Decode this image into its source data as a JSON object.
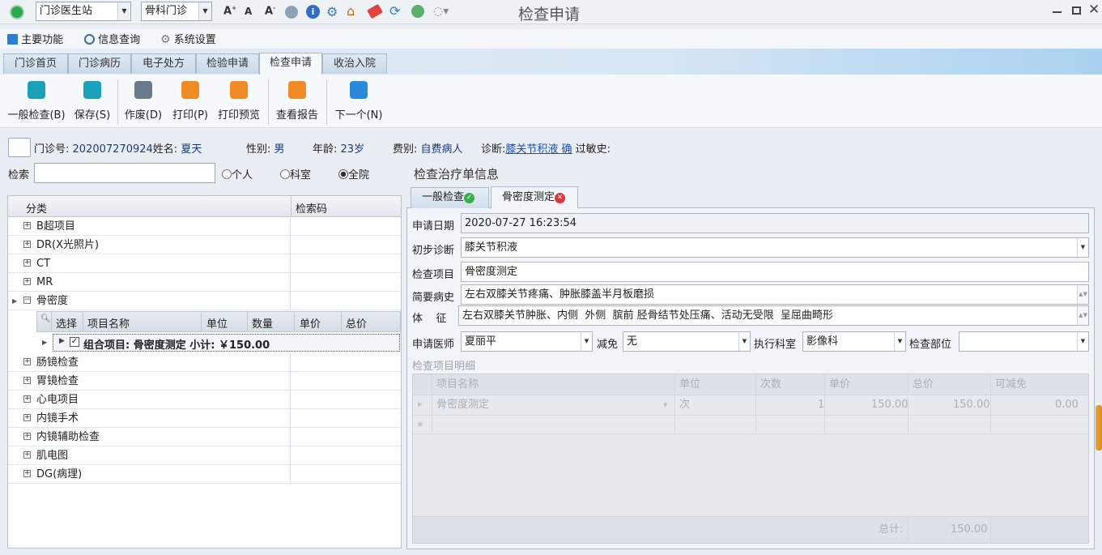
{
  "title": "检查申请",
  "topbar": {
    "station_select": "门诊医生站",
    "dept_select": "骨科门诊",
    "icons": [
      "font-increase-icon",
      "font-normal-icon",
      "font-decrease-icon",
      "users-gear-icon",
      "info-icon",
      "settings-icon",
      "home-icon",
      "eraser-icon",
      "refresh-icon",
      "people-icon",
      "loading-icon"
    ]
  },
  "menu": {
    "items": [
      "主要功能",
      "信息查询",
      "系统设置"
    ]
  },
  "tabs": [
    "门诊首页",
    "门诊病历",
    "电子处方",
    "检验申请",
    "检查申请",
    "收治入院"
  ],
  "active_tab": 4,
  "toolbar": {
    "buttons": [
      "一般检查(B)",
      "保存(S)",
      "作废(D)",
      "打印(P)",
      "打印预览",
      "查看报告",
      "下一个(N)"
    ],
    "colors": [
      "#1aa0b8",
      "#1aa0b8",
      "#6a7b8c",
      "#f08a24",
      "#f08a24",
      "#f08a24",
      "#2a8ad8"
    ]
  },
  "patient": {
    "clinic_no_label": "门诊号:",
    "clinic_no": "202007270924",
    "name_label": "姓名:",
    "name": "夏天",
    "gender_label": "性别:",
    "gender": "男",
    "age_label": "年龄:",
    "age": "23岁",
    "fee_label": "费别:",
    "fee": "自费病人",
    "diag_label": "诊断:",
    "diag": "膝关节积液 确",
    "allergy_label": "过敏史:"
  },
  "search": {
    "label": "检索",
    "value": "",
    "radios": [
      "个人",
      "科室",
      "全院"
    ],
    "selected": 2
  },
  "tree": {
    "headers": [
      "分类",
      "检索码"
    ],
    "items_top": [
      "B超项目",
      "DR(X光照片)",
      "CT",
      "MR",
      "骨密度"
    ],
    "sub_headers": [
      "选择",
      "项目名称",
      "单位",
      "数量",
      "单价",
      "总价"
    ],
    "group_row": "组合项目: 骨密度测定 小计: ￥150.00",
    "items_bottom": [
      "肠镜检查",
      "胃镜检查",
      "心电项目",
      "内镜手术",
      "内镜辅助检查",
      "肌电图",
      "DG(病理)"
    ]
  },
  "right": {
    "section_title": "检查治疗单信息",
    "tabs": [
      "一般检查",
      "骨密度测定"
    ],
    "fields": {
      "apply_date_label": "申请日期",
      "apply_date": "2020-07-27 16:23:54",
      "prelim_diag_label": "初步诊断",
      "prelim_diag": "膝关节积液",
      "exam_item_label": "检查项目",
      "exam_item": "骨密度测定",
      "history_label": "简要病史",
      "history": "左右双膝关节疼痛、肿胀膝盖半月板磨损",
      "signs_label": "体    征",
      "signs": "左右双膝关节肿胀、内侧  外侧  膑前 胫骨结节处压痛、活动无受限  呈屈曲畸形",
      "doctor_label": "申请医师",
      "doctor": "夏丽平",
      "discount_label": "减免",
      "discount": "无",
      "exec_dept_label": "执行科室",
      "exec_dept": "影像科",
      "part_label": "检查部位",
      "part": ""
    },
    "detail": {
      "title": "检查项目明细",
      "headers": [
        "项目名称",
        "单位",
        "次数",
        "单价",
        "总价",
        "可减免"
      ],
      "row": {
        "name": "骨密度测定",
        "unit": "次",
        "times": "1",
        "price": "150.00",
        "total": "150.00",
        "discountable": "0.00"
      },
      "total_label": "总计:",
      "total": "150.00"
    }
  }
}
